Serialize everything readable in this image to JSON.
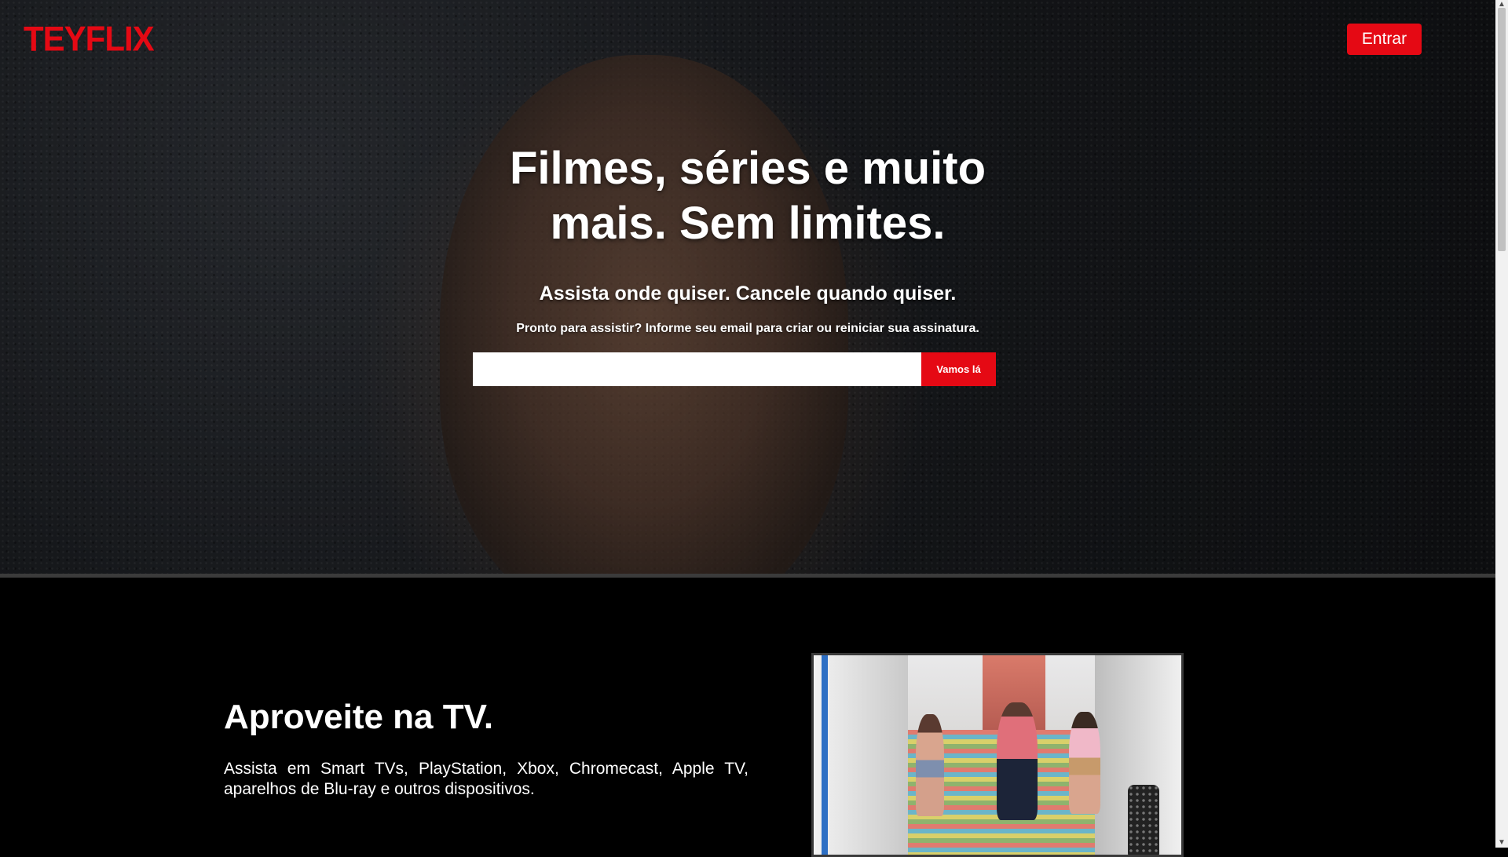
{
  "header": {
    "logo": "TEYFLIX",
    "signin_label": "Entrar"
  },
  "hero": {
    "title": "Filmes, séries e muito mais. Sem limites.",
    "subtitle": "Assista onde quiser. Cancele quando quiser.",
    "cta_text": "Pronto para assistir? Informe seu email para criar ou reiniciar sua assinatura.",
    "email_value": "",
    "email_placeholder": "",
    "button_label": "Vamos lá"
  },
  "tv_section": {
    "title": "Aproveite na TV.",
    "description": "Assista em Smart TVs, PlayStation, Xbox, Chromecast, Apple TV, aparelhos de Blu-ray e outros dispositivos."
  },
  "scrollbar": {
    "up_icon": "chevron-up-icon",
    "down_icon": "chevron-down-icon"
  },
  "colors": {
    "brand": "#e50914",
    "background": "#000000"
  }
}
